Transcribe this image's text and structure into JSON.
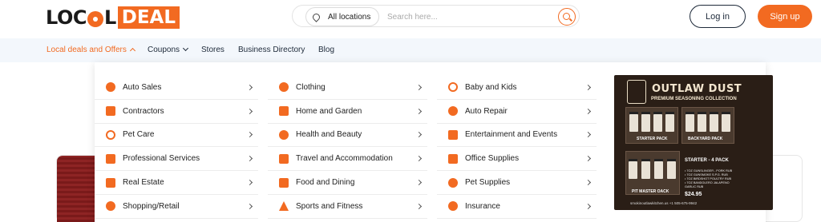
{
  "brand": {
    "logo_left": "LOC",
    "logo_right": "L",
    "logo_deal": "DEAL",
    "accent": "#f26a21"
  },
  "search": {
    "location_label": "All locations",
    "placeholder": "Search here..."
  },
  "auth": {
    "login_label": "Log in",
    "signup_label": "Sign up"
  },
  "nav": {
    "items": [
      {
        "label": "Local deals and Offers"
      },
      {
        "label": "Coupons"
      },
      {
        "label": "Stores"
      },
      {
        "label": "Business Directory"
      },
      {
        "label": "Blog"
      }
    ]
  },
  "menu": {
    "col1": [
      {
        "label": "Auto Sales",
        "icon": "car-icon"
      },
      {
        "label": "Contractors",
        "icon": "contractor-icon"
      },
      {
        "label": "Pet Care",
        "icon": "pet-care-icon"
      },
      {
        "label": "Professional Services",
        "icon": "briefcase-icon"
      },
      {
        "label": "Real Estate",
        "icon": "building-icon"
      },
      {
        "label": "Shopping/Retail",
        "icon": "shopping-icon"
      }
    ],
    "col2": [
      {
        "label": "Clothing",
        "icon": "clothing-icon"
      },
      {
        "label": "Home and Garden",
        "icon": "home-icon"
      },
      {
        "label": "Health and Beauty",
        "icon": "beauty-icon"
      },
      {
        "label": "Travel and Accommodation",
        "icon": "suitcase-icon"
      },
      {
        "label": "Food and Dining",
        "icon": "food-icon"
      },
      {
        "label": "Sports and Fitness",
        "icon": "trophy-icon"
      }
    ],
    "col3": [
      {
        "label": "Baby and Kids",
        "icon": "baby-icon"
      },
      {
        "label": "Auto Repair",
        "icon": "wrench-icon"
      },
      {
        "label": "Entertainment and Events",
        "icon": "ticket-icon"
      },
      {
        "label": "Office Supplies",
        "icon": "office-icon"
      },
      {
        "label": "Pet Supplies",
        "icon": "pet-supplies-icon"
      },
      {
        "label": "Insurance",
        "icon": "insurance-icon"
      }
    ]
  },
  "promo": {
    "title": "OUTLAW DUST",
    "subtitle": "PREMIUM SEASONING COLLECTION",
    "packs": [
      "STARTER PACK",
      "BACKYARD PACK",
      "STARTER - 4 PACK",
      "PIT MASTER OACK"
    ],
    "starter_items": [
      "• 7OZ GUNSLINGER - PORK RUB",
      "• 7OZ GUNSMOKE S.P.G. RUB",
      "• 7OZ BIRDSHOT POULTRY RUB",
      "• 7OZ BANDOLERO JALAPENO GARLIC RUB"
    ],
    "price": "$24.95",
    "footer": "smokinoutlawkitchen.us          +1 505-675-9942"
  }
}
